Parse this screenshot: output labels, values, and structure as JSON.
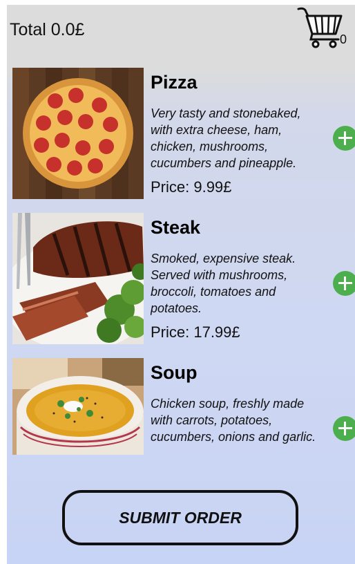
{
  "header": {
    "total_label": "Total 0.0£",
    "cart_count": "0"
  },
  "items": [
    {
      "name": "Pizza",
      "description": "Very tasty and stonebaked, with extra cheese, ham, chicken, mushrooms, cucumbers and pineapple.",
      "price": "Price: 9.99£"
    },
    {
      "name": "Steak",
      "description": "Smoked, expensive steak. Served with mushrooms, broccoli, tomatoes and potatoes.",
      "price": "Price: 17.99£"
    },
    {
      "name": "Soup",
      "description": "Chicken soup, freshly made with carrots, potatoes, cucumbers, onions and garlic."
    }
  ],
  "submit_label": "SUBMIT ORDER",
  "colors": {
    "add_button": "#4cae4c",
    "header_bg": "#dcdcdc"
  }
}
